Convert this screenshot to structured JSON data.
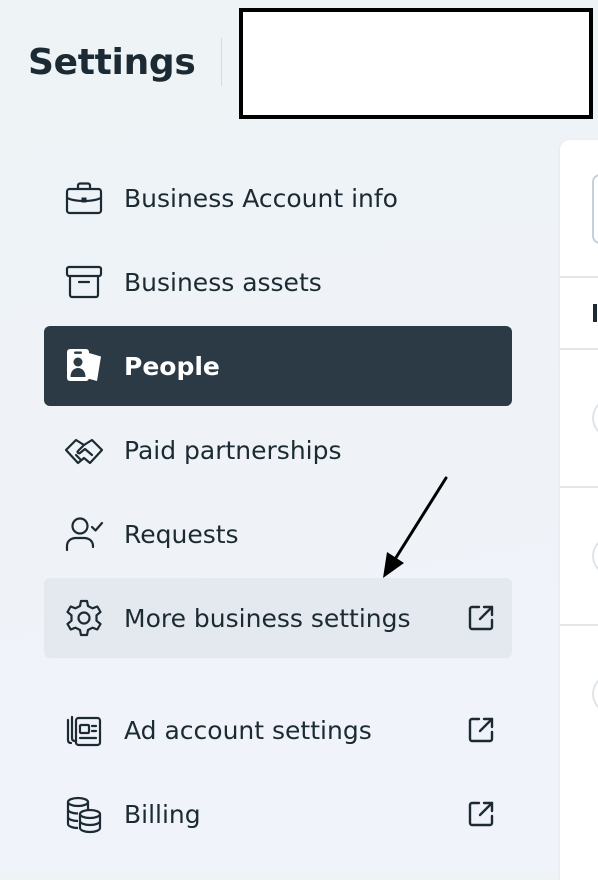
{
  "header": {
    "title": "Settings"
  },
  "nav": {
    "items": [
      {
        "label": "Business Account info",
        "icon": "briefcase-icon",
        "active": false,
        "external": false
      },
      {
        "label": "Business assets",
        "icon": "archive-box-icon",
        "active": false,
        "external": false
      },
      {
        "label": "People",
        "icon": "people-badge-icon",
        "active": true,
        "external": false
      },
      {
        "label": "Paid partnerships",
        "icon": "handshake-icon",
        "active": false,
        "external": false
      },
      {
        "label": "Requests",
        "icon": "person-check-icon",
        "active": false,
        "external": false
      },
      {
        "label": "More business settings",
        "icon": "gear-icon",
        "active": false,
        "hovered": true,
        "external": true
      },
      {
        "label": "Ad account settings",
        "icon": "ad-account-icon",
        "active": false,
        "external": true
      },
      {
        "label": "Billing",
        "icon": "coins-stack-icon",
        "active": false,
        "external": true
      }
    ]
  },
  "colors": {
    "active_bg": "#2b3a44",
    "hover_bg": "#e4e9ef",
    "text": "#1c2b33",
    "icon_stroke": "#1c2b33"
  }
}
